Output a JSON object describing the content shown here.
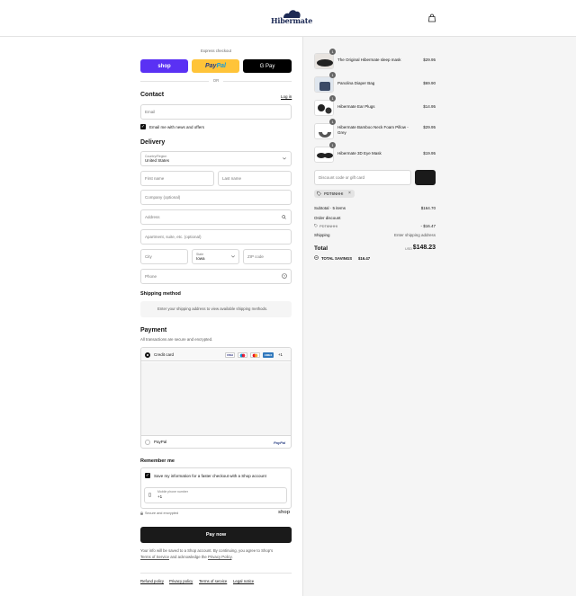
{
  "header": {
    "brand": "Hibermate"
  },
  "express": {
    "title": "Express checkout",
    "shop_label": "shop",
    "paypal_label_a": "Pay",
    "paypal_label_b": "Pal",
    "gpay_label": "G Pay",
    "or_label": "OR"
  },
  "contact": {
    "title": "Contact",
    "login_label": "Log in",
    "email_placeholder": "Email",
    "news_label": "Email me with news and offers",
    "news_checked": true
  },
  "delivery": {
    "title": "Delivery",
    "country_label": "Country/Region",
    "country_value": "United States",
    "first_name": "First name",
    "last_name": "Last name",
    "company": "Company (optional)",
    "address": "Address",
    "apartment": "Apartment, suite, etc. (optional)",
    "city": "City",
    "state_label": "State",
    "state_value": "Iowa",
    "zip": "ZIP code",
    "phone": "Phone"
  },
  "shipping": {
    "title": "Shipping method",
    "note": "Enter your shipping address to view available shipping methods."
  },
  "payment": {
    "title": "Payment",
    "subtitle": "All transactions are secure and encrypted.",
    "credit_card_label": "Credit card",
    "cards": [
      "VISA",
      "MC",
      "MC",
      "AMEX"
    ],
    "more_cards": "+1",
    "paypal_label": "PayPal",
    "paypal_logo": "PayPal"
  },
  "remember": {
    "title": "Remember me",
    "save_label": "Save my information for a faster checkout with a Shop account",
    "phone_label": "Mobile phone number",
    "phone_value": "+1",
    "secure_label": "Secure and encrypted",
    "shop_label": "shop"
  },
  "pay_button": "Pay now",
  "legal": {
    "text_a": "Your info will be saved to a Shop account. By continuing, you agree to Shop's",
    "terms": "Terms of Service",
    "text_b": "and acknowledge the",
    "privacy": "Privacy Policy",
    "text_c": "."
  },
  "footer": [
    "Refund policy",
    "Privacy policy",
    "Terms of service",
    "Legal notice"
  ],
  "cart": {
    "items": [
      {
        "name": "The Original Hibermate sleep mask",
        "price": "$29.95",
        "qty": "1"
      },
      {
        "name": "Panolina Diaper Bag",
        "price": "$69.90",
        "qty": "1"
      },
      {
        "name": "Hibermate Ear Plugs",
        "price": "$14.95",
        "qty": "1"
      },
      {
        "name": "Hibermate Bamboo Neck Foam Pillow - Grey",
        "price": "$29.95",
        "qty": "1"
      },
      {
        "name": "Hibermate 3D Eye Mask",
        "price": "$19.95",
        "qty": "1"
      }
    ],
    "discount_placeholder": "Discount code or gift card",
    "applied_code": "PDT6NHHI",
    "subtotal_label": "Subtotal · 5 items",
    "subtotal_value": "$164.70",
    "order_discount_label": "Order discount",
    "discount_code": "PDT6NHHI",
    "discount_value": "- $16.47",
    "shipping_label": "Shipping",
    "shipping_value": "Enter shipping address",
    "total_label": "Total",
    "currency": "USD",
    "total_value": "$148.23",
    "savings_label": "TOTAL SAVINGS",
    "savings_value": "$16.47"
  },
  "colors": {
    "shop": "#5a31f4",
    "paypal": "#ffc439",
    "gpay": "#000000",
    "pay_button": "#1a1a1a",
    "panel": "#f5f5f5"
  }
}
